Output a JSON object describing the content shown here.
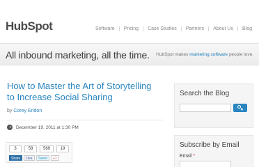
{
  "header": {
    "logo_text": "HubSpot",
    "nav": [
      "Software",
      "Pricing",
      "Case Studies",
      "Partners",
      "About Us",
      "Blog"
    ]
  },
  "banner": {
    "tagline": "All inbound marketing, all the time.",
    "right_prefix": "HubSpot makes",
    "right_link": "marketing software",
    "right_suffix": "people love."
  },
  "post": {
    "title": "How to Master the Art of Storytelling to Increase Social Sharing",
    "by": "by",
    "author": "Corey Eridon",
    "date": "December 19, 2011 at 1:30 PM"
  },
  "share": {
    "counts": [
      "3",
      "58",
      "569",
      "19"
    ],
    "buttons": [
      "Share",
      "Like",
      "Tweet",
      "+1"
    ]
  },
  "sidebar": {
    "search_title": "Search the Blog",
    "subscribe_title": "Subscribe by Email",
    "email_label": "Email",
    "email_required": "*"
  },
  "colors": {
    "link_blue": "#2a85c0",
    "logo_orange": "#f47622"
  }
}
